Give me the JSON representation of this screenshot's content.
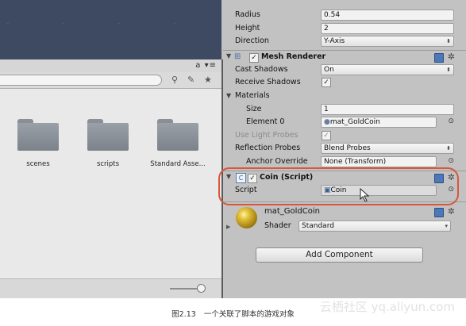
{
  "project": {
    "tab_icons": "a ▾≡",
    "search_placeholder": "",
    "folders": [
      "scenes",
      "scripts",
      "Standard Asse..."
    ]
  },
  "inspector": {
    "radius": {
      "label": "Radius",
      "value": "0.54"
    },
    "height": {
      "label": "Height",
      "value": "2"
    },
    "direction": {
      "label": "Direction",
      "value": "Y-Axis"
    },
    "mesh_renderer": {
      "title": "Mesh Renderer"
    },
    "cast_shadows": {
      "label": "Cast Shadows",
      "value": "On"
    },
    "receive_shadows": {
      "label": "Receive Shadows"
    },
    "materials": {
      "label": "Materials"
    },
    "size": {
      "label": "Size",
      "value": "1"
    },
    "element0": {
      "label": "Element 0",
      "value": "mat_GoldCoin"
    },
    "light_probes": {
      "label": "Use Light Probes"
    },
    "reflection_probes": {
      "label": "Reflection Probes",
      "value": "Blend Probes"
    },
    "anchor_override": {
      "label": "Anchor Override",
      "value": "None (Transform)"
    },
    "coin_script": {
      "title": "Coin (Script)",
      "script_label": "Script",
      "script_value": "Coin"
    },
    "material": {
      "name": "mat_GoldCoin",
      "shader_label": "Shader",
      "shader_value": "Standard"
    },
    "add_component": "Add Component"
  },
  "caption": {
    "figure": "图2.13",
    "text": "一个关联了脚本的游戏对象"
  },
  "watermark": "云栖社区 yq.aliyun.com",
  "colors": {
    "highlight": "#d9573b",
    "gold": "#c9a227",
    "inspector_bg": "#c2c2c2"
  }
}
